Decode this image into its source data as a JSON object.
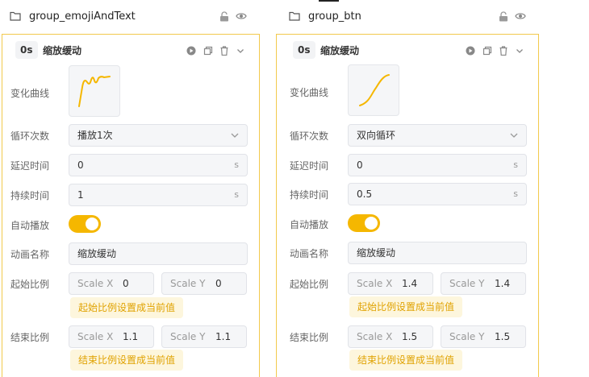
{
  "colors": {
    "accent": "#f5b700",
    "border": "#f2c94c",
    "field_bg": "#f5f6f8",
    "hint_text": "#e0a200"
  },
  "panels": [
    {
      "group_title": "group_emojiAndText",
      "time": "0s",
      "anim_name": "缩放缓动",
      "labels": {
        "curve": "变化曲线",
        "loop": "循环次数",
        "delay": "延迟时间",
        "duration": "持续时间",
        "autoplay": "自动播放",
        "name": "动画名称",
        "start_scale": "起始比例",
        "end_scale": "结束比例"
      },
      "loop_value": "播放1次",
      "delay_value": "0",
      "duration_value": "1",
      "unit": "s",
      "autoplay_on": true,
      "name_value": "缩放缓动",
      "start_scale": {
        "x_label": "Scale X",
        "x": "0",
        "y_label": "Scale Y",
        "y": "0",
        "button": "起始比例设置成当前值"
      },
      "end_scale": {
        "x_label": "Scale X",
        "x": "1.1",
        "y_label": "Scale Y",
        "y": "1.1",
        "button": "结束比例设置成当前值"
      },
      "curve_type": "overshoot-wobble"
    },
    {
      "group_title": "group_btn",
      "time": "0s",
      "anim_name": "缩放缓动",
      "labels": {
        "curve": "变化曲线",
        "loop": "循环次数",
        "delay": "延迟时间",
        "duration": "持续时间",
        "autoplay": "自动播放",
        "name": "动画名称",
        "start_scale": "起始比例",
        "end_scale": "结束比例"
      },
      "loop_value": "双向循环",
      "delay_value": "0",
      "duration_value": "0.5",
      "unit": "s",
      "autoplay_on": true,
      "name_value": "缩放缓动",
      "start_scale": {
        "x_label": "Scale X",
        "x": "1.4",
        "y_label": "Scale Y",
        "y": "1.4",
        "button": "起始比例设置成当前值"
      },
      "end_scale": {
        "x_label": "Scale X",
        "x": "1.5",
        "y_label": "Scale Y",
        "y": "1.5",
        "button": "结束比例设置成当前值"
      },
      "curve_type": "ease-in-out"
    }
  ]
}
